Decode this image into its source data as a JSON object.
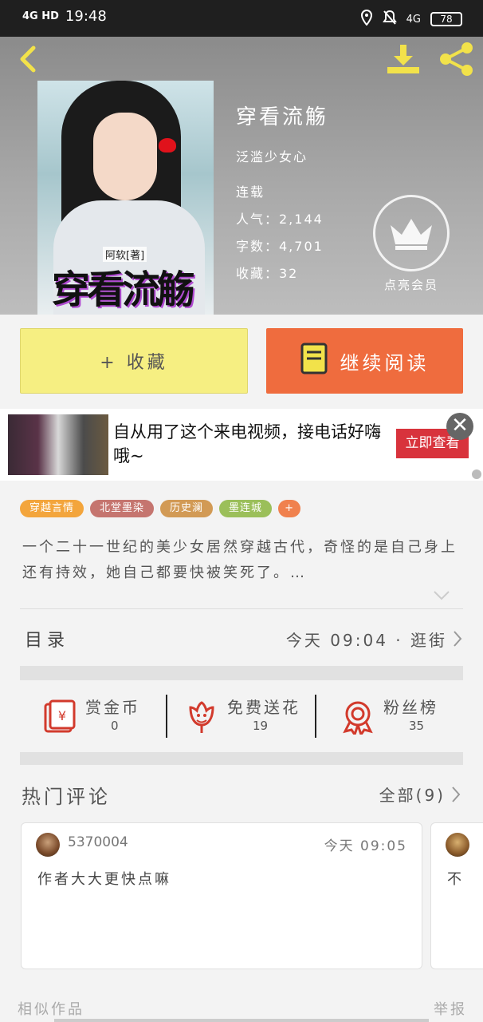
{
  "status_bar": {
    "network": "4G HD",
    "time": "19:48",
    "network2": "4G",
    "battery": "78"
  },
  "header": {
    "cover": {
      "author_tag": "阿软[著]",
      "title_art": "穿看流觞"
    },
    "book": {
      "title": "穿看流觞",
      "author": "泛滥少女心",
      "status": "连载",
      "popularity": "人气：2,144",
      "word_count": "字数：4,701",
      "favorites": "收藏：32"
    },
    "vip_label": "点亮会员"
  },
  "actions": {
    "collect": "+ 收藏",
    "read": "继续阅读"
  },
  "ad": {
    "text": "自从用了这个来电视频，接电话好嗨哦~",
    "cta": "立即查看",
    "close": "✕"
  },
  "tags": [
    {
      "label": "穿越言情",
      "color": "#f3a53c"
    },
    {
      "label": "北堂墨染",
      "color": "#c5756f"
    },
    {
      "label": "历史澜",
      "color": "#d29a55"
    },
    {
      "label": "墨连城",
      "color": "#9bbf5a"
    },
    {
      "label": "+",
      "color": "#f0814e"
    }
  ],
  "description": "一个二十一世纪的美少女居然穿越古代，奇怪的是自己身上还有持效，她自己都要快被笑死了。…",
  "toc": {
    "label": "目录",
    "meta": "今天 09:04 · 逛街"
  },
  "stats": [
    {
      "name": "赏金币",
      "value": "0",
      "icon": "red-envelope-icon"
    },
    {
      "name": "免费送花",
      "value": "19",
      "icon": "flower-icon"
    },
    {
      "name": "粉丝榜",
      "value": "35",
      "icon": "medal-icon"
    }
  ],
  "comments": {
    "title": "热门评论",
    "all": "全部(9)",
    "items": [
      {
        "user": "5370004",
        "time": "今天 09:05",
        "text": "作者大大更快点嘛"
      },
      {
        "user": "",
        "time": "",
        "text": "不"
      }
    ]
  },
  "footer": {
    "similar": "相似作品",
    "report": "举报"
  },
  "colors": {
    "collect_bg": "#f6ef82",
    "read_bg": "#ef6c3e",
    "ad_cta": "#d8333c",
    "header_icons": "#f2e24a"
  }
}
